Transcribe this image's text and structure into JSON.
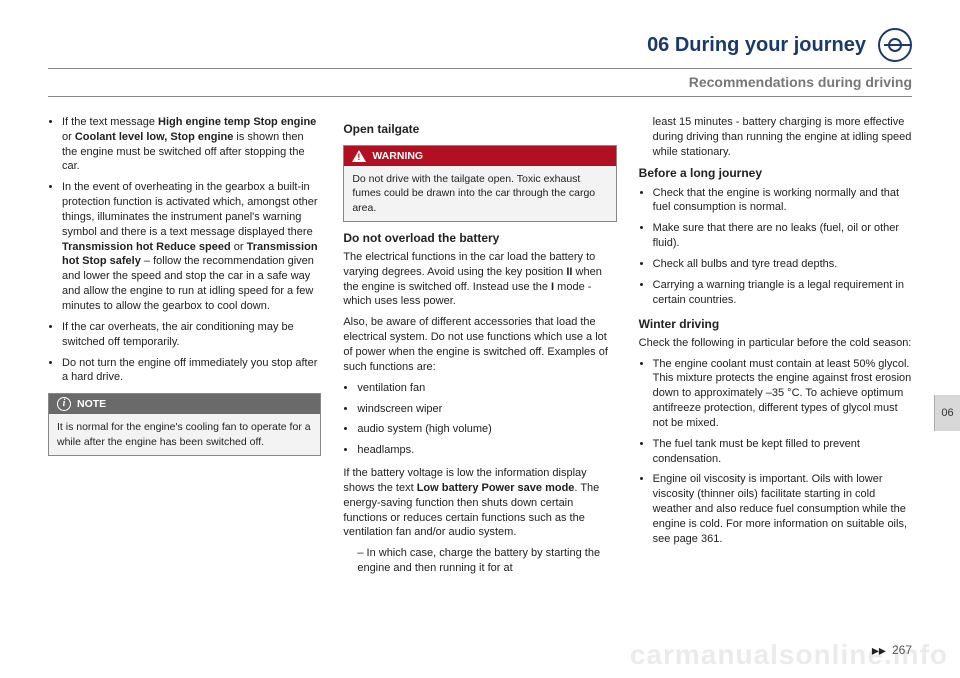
{
  "header": {
    "chapter": "06 During your journey",
    "section": "Recommendations during driving"
  },
  "col1": {
    "bullets": [
      "If the text message <b>High engine temp Stop engine</b> or <b>Coolant level low, Stop engine</b> is shown then the engine must be switched off after stopping the car.",
      "In the event of overheating in the gearbox a built-in protection function is activated which, amongst other things, illuminates the instrument panel's warning symbol and there is a text message displayed there <b>Transmission hot Reduce speed</b> or <b>Transmission hot Stop safely</b> – follow the recommendation given and lower the speed and stop the car in a safe way and allow the engine to run at idling speed for a few minutes to allow the gearbox to cool down.",
      "If the car overheats, the air conditioning may be switched off temporarily.",
      "Do not turn the engine off immediately you stop after a hard drive."
    ],
    "note": {
      "label": "NOTE",
      "body": "It is normal for the engine's cooling fan to operate for a while after the engine has been switched off."
    }
  },
  "col2": {
    "h_open": "Open tailgate",
    "warning": {
      "label": "WARNING",
      "body": "Do not drive with the tailgate open. Toxic exhaust fumes could be drawn into the car through the cargo area."
    },
    "h_batt": "Do not overload the battery",
    "p_batt1": "The electrical functions in the car load the battery to varying degrees. Avoid using the key position <b>II</b> when the engine is switched off. Instead use the <b>I</b> mode - which uses less power.",
    "p_batt2": "Also, be aware of different accessories that load the electrical system. Do not use functions which use a lot of power when the engine is switched off. Examples of such functions are:",
    "batt_list": [
      "ventilation fan",
      "windscreen wiper",
      "audio system (high volume)",
      "headlamps."
    ],
    "p_batt3": "If the battery voltage is low the information display shows the text <b>Low battery Power save mode</b>. The energy-saving function then shuts down certain functions or reduces certain functions such as the ventilation fan and/or audio system.",
    "batt_sub": "In which case, charge the battery by starting the engine and then running it for at"
  },
  "col3": {
    "cont": "least 15 minutes - battery charging is more effective during driving than running the engine at idling speed while stationary.",
    "h_before": "Before a long journey",
    "before_list": [
      "Check that the engine is working normally and that fuel consumption is normal.",
      "Make sure that there are no leaks (fuel, oil or other fluid).",
      "Check all bulbs and tyre tread depths.",
      "Carrying a warning triangle is a legal requirement in certain countries."
    ],
    "h_winter": "Winter driving",
    "p_winter": "Check the following in particular before the cold season:",
    "winter_list": [
      "The engine coolant must contain at least 50% glycol. This mixture protects the engine against frost erosion down to approximately –35 °C. To achieve optimum antifreeze protection, different types of glycol must not be mixed.",
      "The fuel tank must be kept filled to prevent condensation.",
      "Engine oil viscosity is important. Oils with lower viscosity (thinner oils) facilitate starting in cold weather and also reduce fuel consumption while the engine is cold. For more information on suitable oils, see page 361."
    ]
  },
  "tab": "06",
  "pageNumber": "267",
  "watermark": "carmanualsonline.info"
}
